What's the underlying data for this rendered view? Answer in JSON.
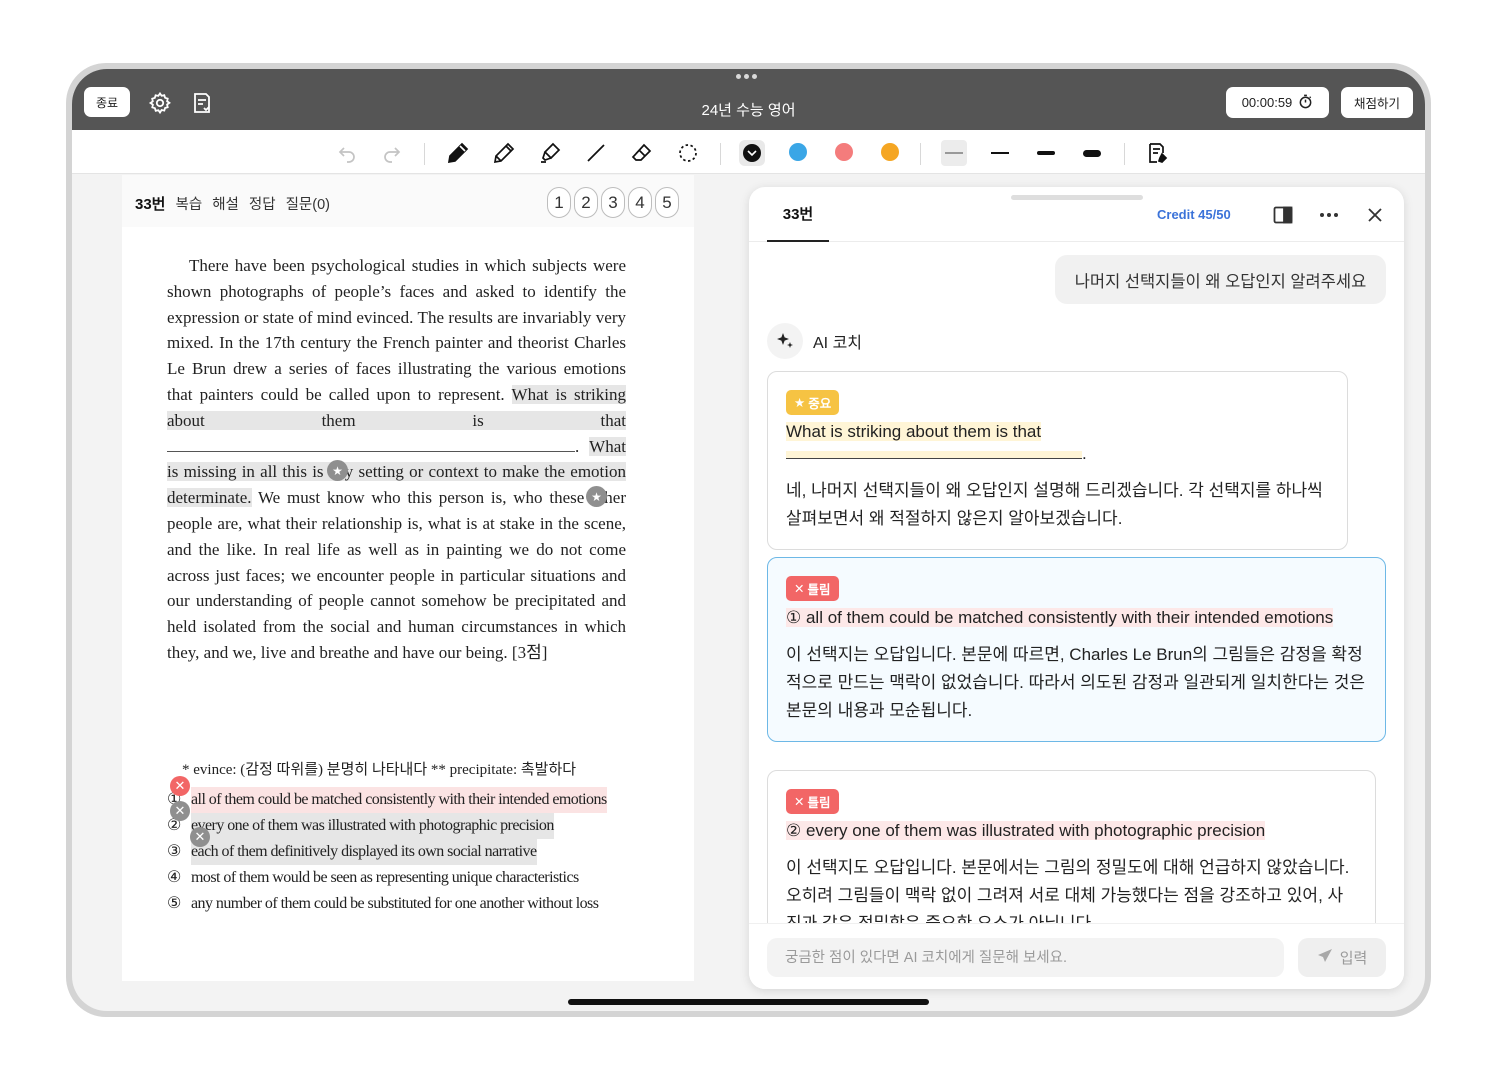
{
  "topbar": {
    "exit_label": "종료",
    "title": "24년 수능 영어",
    "timer": "00:00:59",
    "grade_label": "채점하기"
  },
  "toolbar": {
    "tools": [
      "undo-icon",
      "redo-icon",
      "pen-icon",
      "pencil-icon",
      "highlighter-icon",
      "line-icon",
      "eraser-icon",
      "lasso-icon"
    ],
    "colors": [
      "#111111",
      "#3aa6e6",
      "#f47c7c",
      "#f5a623"
    ],
    "selected_color": "#111111"
  },
  "question": {
    "number": "33번",
    "tabs": [
      "복습",
      "해설",
      "정답",
      "질문(0)"
    ],
    "choice_buttons": [
      "1",
      "2",
      "3",
      "4",
      "5"
    ],
    "passage": {
      "p1": "There have been psychological studies in which subjects were shown photographs of people’s faces and asked to identify the expression or state of mind evinced. The results are invariably very mixed. In the 17th century the French painter and theorist Charles Le Brun drew a series of faces illustrating the various emotions that painters could be called upon to represent.",
      "hl1": "What is striking about them is that",
      "period": ".",
      "hl2": "What is missing in all this is any setting or context to make the emotion determinate.",
      "p2": "We must know who this person is, who these other people are, what their relationship is, what is at stake in the scene, and the like. In real life as well as in painting we do not come across just faces; we encounter people in particular situations and our understanding of people cannot somehow be precipitated and held isolated from the social and human circumstances in which they, and we, live and breathe and have our being.",
      "points": "[3점]"
    },
    "gloss": "* evince: (감정 따위를) 분명히 나타내다   ** precipitate: 촉발하다",
    "options": [
      {
        "num": "①",
        "text": "all of them could be matched consistently with their intended emotions"
      },
      {
        "num": "②",
        "text": "every one of them was illustrated with photographic precision"
      },
      {
        "num": "③",
        "text": "each of them definitively displayed its own social narrative"
      },
      {
        "num": "④",
        "text": "most of them would be seen as representing unique characteristics"
      },
      {
        "num": "⑤",
        "text": "any number of them could be substituted for one another without loss"
      }
    ]
  },
  "ai_panel": {
    "tab": "33번",
    "credit": "Credit 45/50",
    "user_message": "나머지 선택지들이 왜 오답인지 알려주세요",
    "coach_label": "AI 코치",
    "cards": [
      {
        "tag": "중요",
        "tag_type": "important",
        "quote": "What is striking about them is that",
        "body": "네, 나머지 선택지들이 왜 오답인지 설명해 드리겠습니다. 각 선택지를 하나씩 살펴보면서 왜 적절하지 않은지 알아보겠습니다."
      },
      {
        "tag": "틀림",
        "tag_type": "wrong",
        "quote": "① all of them could be matched consistently with their intended emotions",
        "body": "이 선택지는 오답입니다. 본문에 따르면, Charles Le Brun의 그림들은 감정을 확정적으로 만드는 맥락이 없었습니다. 따라서 의도된 감정과 일관되게 일치한다는 것은 본문의 내용과 모순됩니다."
      },
      {
        "tag": "틀림",
        "tag_type": "wrong",
        "quote": "② every one of them was illustrated with photographic precision",
        "body": "이 선택지도 오답입니다. 본문에서는 그림의 정밀도에 대해 언급하지 않았습니다. 오히려 그림들이 맥락 없이 그려져 서로 대체 가능했다는 점을 강조하고 있어, 사진과 같은 정밀함은 중요한 요소가 아닙니다."
      }
    ],
    "input_placeholder": "궁금한 점이 있다면 AI 코치에게 질문해 보세요.",
    "send_label": "입력"
  }
}
